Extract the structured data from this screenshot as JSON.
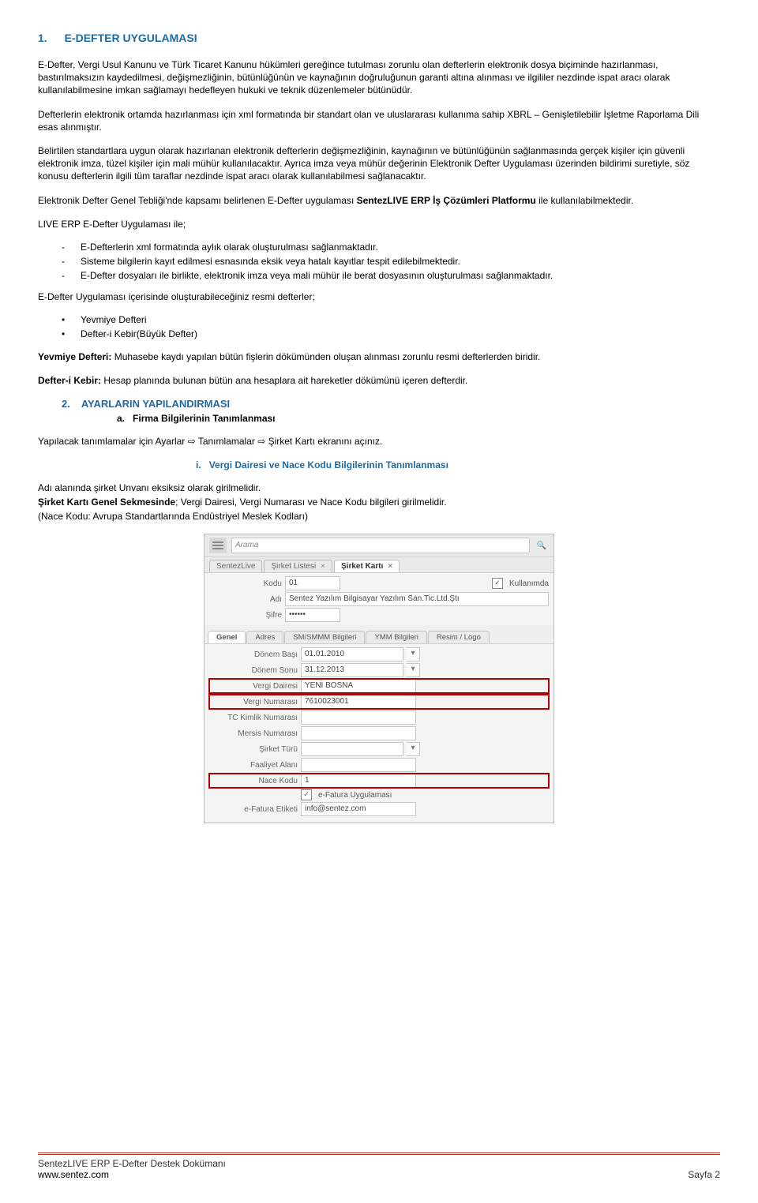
{
  "doc": {
    "h1_num": "1.",
    "h1_title": "E-DEFTER UYGULAMASI",
    "p1": "E-Defter, Vergi Usul Kanunu ve Türk Ticaret Kanunu hükümleri gereğince tutulması zorunlu olan defterlerin elektronik dosya biçiminde hazırlanması, bastırılmaksızın kaydedilmesi, değişmezliğinin, bütünlüğünün ve kaynağının doğruluğunun garanti altına alınması ve ilgililer nezdinde ispat aracı olarak kullanılabilmesine imkan sağlamayı hedefleyen hukuki ve teknik düzenlemeler bütünüdür.",
    "p2": "Defterlerin elektronik ortamda hazırlanması için xml formatında bir standart olan ve uluslararası kullanıma sahip XBRL – Genişletilebilir İşletme Raporlama Dili esas alınmıştır.",
    "p3": "Belirtilen standartlara uygun olarak hazırlanan elektronik defterlerin değişmezliğinin, kaynağının ve bütünlüğünün sağlanmasında gerçek kişiler için güvenli elektronik imza, tüzel kişiler için mali mühür kullanılacaktır. Ayrıca imza veya mühür değerinin Elektronik Defter Uygulaması üzerinden bildirimi suretiyle, söz konusu defterlerin ilgili tüm taraflar nezdinde ispat aracı olarak kullanılabilmesi sağlanacaktır.",
    "p4_pre": "Elektronik Defter Genel Tebliği'nde kapsamı belirlenen E-Defter uygulaması ",
    "p4_b": "SentezLIVE ERP İş Çözümleri Platformu",
    "p4_post": " ile kullanılabilmektedir.",
    "p5": "LIVE ERP E-Defter Uygulaması ile;",
    "dash_items": [
      "E-Defterlerin xml formatında aylık olarak oluşturulması sağlanmaktadır.",
      "Sisteme bilgilerin kayıt edilmesi esnasında eksik veya hatalı kayıtlar tespit edilebilmektedir.",
      "E-Defter dosyaları ile birlikte, elektronik imza veya mali mühür ile berat dosyasının oluşturulması sağlanmaktadır."
    ],
    "p6": "E-Defter Uygulaması içerisinde oluşturabileceğiniz resmi defterler;",
    "bullet_items": [
      "Yevmiye Defteri",
      "Defter-i Kebir(Büyük Defter)"
    ],
    "p7_b": "Yevmiye Defteri:",
    "p7": " Muhasebe kaydı yapılan bütün fişlerin dökümünden oluşan alınması zorunlu resmi defterlerden biridir.",
    "p8_b": "Defter-i Kebir:",
    "p8": " Hesap planında bulunan bütün ana hesaplara ait hareketler dökümünü içeren defterdir.",
    "h2_num": "2.",
    "h2_title": "AYARLARIN YAPILANDIRMASI",
    "h2a_num": "a.",
    "h2a_title": "Firma Bilgilerinin Tanımlanması",
    "p9_a": "Yapılacak tanımlamalar için Ayarlar ",
    "p9_b": " Tanımlamalar ",
    "p9_c": " Şirket Kartı ekranını açınız.",
    "hi_num": "i.",
    "hi_title": "Vergi Dairesi ve Nace Kodu Bilgilerinin Tanımlanması",
    "p10": "Adı alanında şirket Unvanı eksiksiz olarak girilmelidir.",
    "p11_b": "Şirket Kartı Genel Sekmesinde",
    "p11": "; Vergi Dairesi, Vergi Numarası ve Nace Kodu bilgileri girilmelidir.",
    "p12": "(Nace Kodu: Avrupa Standartlarında Endüstriyel Meslek Kodları)"
  },
  "shot": {
    "search_placeholder": "Arama",
    "tabs": [
      "SentezLive",
      "Şirket Listesi",
      "Şirket Kartı"
    ],
    "form": {
      "kodu_label": "Kodu",
      "kodu_val": "01",
      "kullanimda": "Kullanımda",
      "adi_label": "Adı",
      "adi_val": "Sentez Yazılım Bilgisayar Yazılım San.Tic.Ltd.Ştı",
      "sifre_label": "Şifre",
      "sifre_val": "••••••"
    },
    "subtabs": [
      "Genel",
      "Adres",
      "SM/SMMM Bilgileri",
      "YMM Bilgileri",
      "Resim / Logo"
    ],
    "panel": {
      "donem_basi_label": "Dönem Başı",
      "donem_basi_val": "01.01.2010",
      "donem_sonu_label": "Dönem Sonu",
      "donem_sonu_val": "31.12.2013",
      "vergi_dairesi_label": "Vergi Dairesi",
      "vergi_dairesi_val": "YENİ BOSNA",
      "vergi_no_label": "Vergi Numarası",
      "vergi_no_val": "7610023001",
      "tc_label": "TC Kimlik Numarası",
      "mersis_label": "Mersis Numarası",
      "turu_label": "Şirket Türü",
      "faaliyet_label": "Faaliyet Alanı",
      "nace_label": "Nace Kodu",
      "nace_val": "1",
      "efatura_chk": "e-Fatura Uygulaması",
      "efatura_etiket_label": "e-Fatura Etiketi",
      "efatura_etiket_val": "info@sentez.com"
    }
  },
  "footer": {
    "line1": "SentezLIVE ERP E-Defter Destek Dokümanı",
    "line2": "www.sentez.com",
    "page": "Sayfa 2"
  }
}
